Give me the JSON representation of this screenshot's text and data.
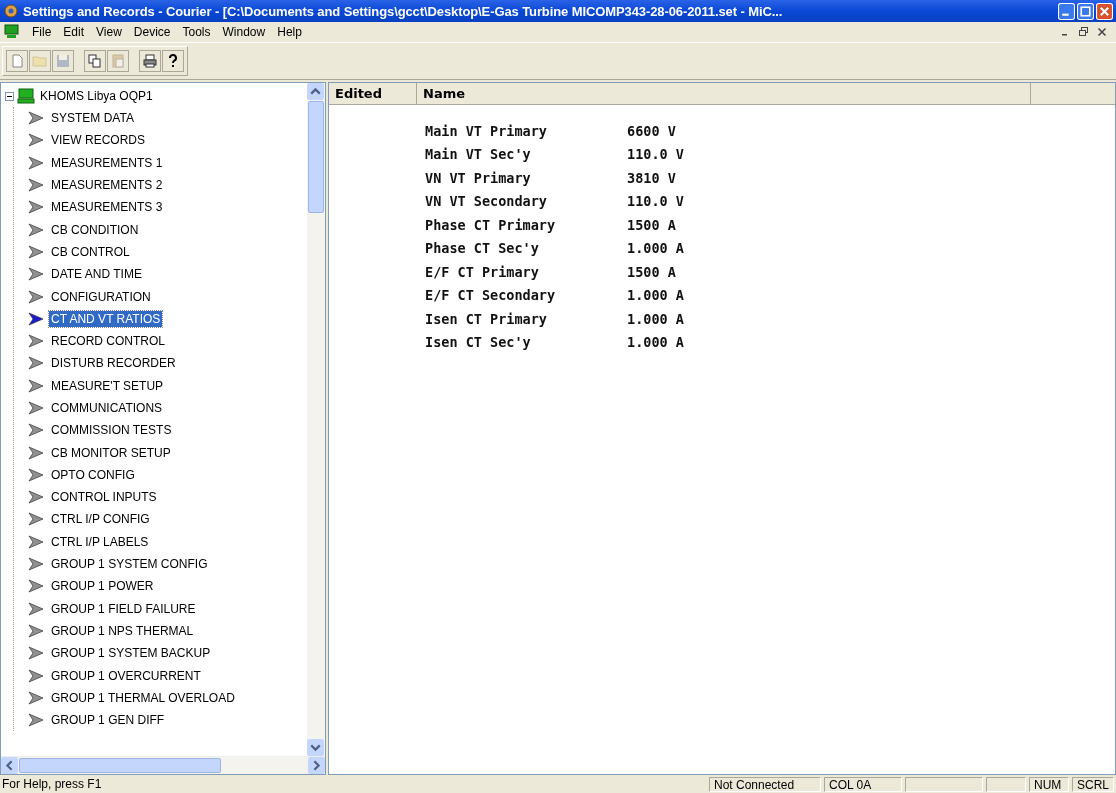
{
  "window": {
    "title": "Settings and Records - Courier - [C:\\Documents and Settings\\gcct\\Desktop\\E-Gas Turbine MICOMP343-28-06-2011.set - MiC..."
  },
  "menu": [
    "File",
    "Edit",
    "View",
    "Device",
    "Tools",
    "Window",
    "Help"
  ],
  "toolbar": [
    {
      "kind": "new",
      "disabled": false
    },
    {
      "kind": "open",
      "disabled": true
    },
    {
      "kind": "save",
      "disabled": true
    },
    {
      "kind": "sep"
    },
    {
      "kind": "copy",
      "disabled": false
    },
    {
      "kind": "paste",
      "disabled": true
    },
    {
      "kind": "sep"
    },
    {
      "kind": "print",
      "disabled": false
    },
    {
      "kind": "help",
      "disabled": false
    }
  ],
  "tree": {
    "label": "KHOMS Libya OQP1",
    "expanded": true,
    "children": [
      {
        "label": "SYSTEM DATA",
        "selected": false
      },
      {
        "label": "VIEW RECORDS",
        "selected": false
      },
      {
        "label": "MEASUREMENTS 1",
        "selected": false
      },
      {
        "label": "MEASUREMENTS 2",
        "selected": false
      },
      {
        "label": "MEASUREMENTS 3",
        "selected": false
      },
      {
        "label": "CB CONDITION",
        "selected": false
      },
      {
        "label": "CB CONTROL",
        "selected": false
      },
      {
        "label": "DATE AND TIME",
        "selected": false
      },
      {
        "label": "CONFIGURATION",
        "selected": false
      },
      {
        "label": "CT AND VT RATIOS",
        "selected": true
      },
      {
        "label": "RECORD CONTROL",
        "selected": false
      },
      {
        "label": "DISTURB RECORDER",
        "selected": false
      },
      {
        "label": "MEASURE'T SETUP",
        "selected": false
      },
      {
        "label": "COMMUNICATIONS",
        "selected": false
      },
      {
        "label": "COMMISSION TESTS",
        "selected": false
      },
      {
        "label": "CB MONITOR SETUP",
        "selected": false
      },
      {
        "label": "OPTO CONFIG",
        "selected": false
      },
      {
        "label": "CONTROL INPUTS",
        "selected": false
      },
      {
        "label": "CTRL I/P CONFIG",
        "selected": false
      },
      {
        "label": "CTRL I/P LABELS",
        "selected": false
      },
      {
        "label": "GROUP 1 SYSTEM CONFIG",
        "selected": false
      },
      {
        "label": "GROUP 1 POWER",
        "selected": false
      },
      {
        "label": "GROUP 1 FIELD FAILURE",
        "selected": false
      },
      {
        "label": "GROUP 1 NPS THERMAL",
        "selected": false
      },
      {
        "label": "GROUP 1 SYSTEM BACKUP",
        "selected": false
      },
      {
        "label": "GROUP 1 OVERCURRENT",
        "selected": false
      },
      {
        "label": "GROUP 1 THERMAL OVERLOAD",
        "selected": false
      },
      {
        "label": "GROUP 1 GEN DIFF",
        "selected": false
      }
    ]
  },
  "table": {
    "columns": [
      "Edited",
      "Name"
    ],
    "rows": [
      {
        "name": "Main VT Primary",
        "value": "6600 V"
      },
      {
        "name": "Main VT Sec'y",
        "value": "110.0 V"
      },
      {
        "name": "VN VT Primary",
        "value": "3810 V"
      },
      {
        "name": "VN VT Secondary",
        "value": "110.0 V"
      },
      {
        "name": "Phase CT Primary",
        "value": "1500 A"
      },
      {
        "name": "Phase CT Sec'y",
        "value": "1.000 A"
      },
      {
        "name": "E/F CT Primary",
        "value": "1500 A"
      },
      {
        "name": "E/F CT Secondary",
        "value": "1.000 A"
      },
      {
        "name": "Isen CT Primary",
        "value": "1.000 A"
      },
      {
        "name": "Isen CT Sec'y",
        "value": "1.000 A"
      }
    ]
  },
  "status_bar": {
    "help": "For Help, press F1",
    "panes": [
      {
        "kind": "text",
        "text": "Not Connected"
      },
      {
        "kind": "text",
        "text": "COL 0A"
      },
      {
        "kind": "blank"
      },
      {
        "kind": "blank"
      },
      {
        "kind": "text",
        "text": "NUM"
      },
      {
        "kind": "text",
        "text": "SCRL"
      }
    ]
  }
}
